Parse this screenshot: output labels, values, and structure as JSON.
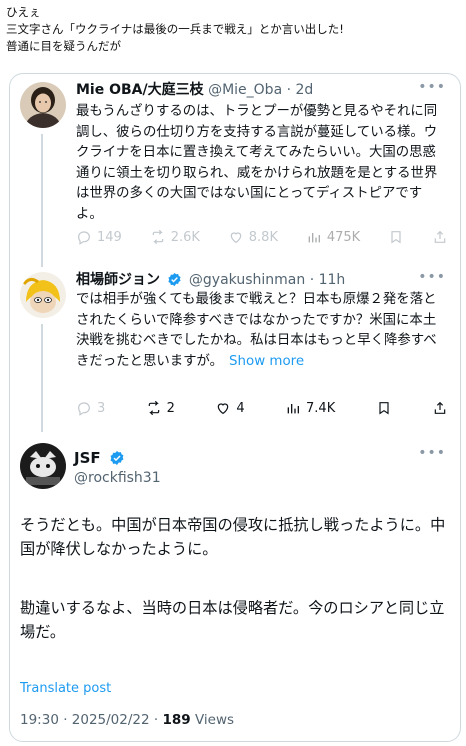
{
  "caption": {
    "line1": "ひえぇ",
    "line2": "三文字さん「ウクライナは最後の一兵まで戦え」とか言い出した!",
    "line3": "普通に目を疑うんだが"
  },
  "tweet1": {
    "name": "Mie OBA/大庭三枝",
    "handle": "@Mie_Oba",
    "time": "· 2d",
    "text": "最もうんざりするのは、トラとプーが優勢と見るやそれに同調し、彼らの仕切り方を支持する言説が蔓延している様。ウクライナを日本に置き換えて考えてみたらいい。大国の思惑通りに領土を切り取られ、威をかけられ放題を是とする世界は世界の多くの大国ではない国にとってディストピアですよ。",
    "replies": "149",
    "reposts": "2.6K",
    "likes": "8.8K",
    "views": "475K"
  },
  "tweet2": {
    "name": "相場師ジョン",
    "handle": "@gyakushinman",
    "time": "· 11h",
    "text": "では相手が強くても最後まで戦えと？日本も原爆２発を落とされたくらいで降参すべきではなかったですか？米国に本土決戦を挑むべきでしたかね。私は日本はもっと早く降参すべきだったと思いますが。",
    "show_more": "Show more",
    "replies": "3",
    "reposts": "2",
    "likes": "4",
    "views": "7.4K"
  },
  "main": {
    "name": "JSF",
    "handle": "@rockfish31",
    "para1": "そうだとも。中国が日本帝国の侵攻に抵抗し戦ったように。中国が降伏しなかったように。",
    "para2": "勘違いするなよ、当時の日本は侵略者だ。今のロシアと同じ立場だ。",
    "translate": "Translate post",
    "datetime": "19:30 · 2025/02/22 · ",
    "views_count": "189",
    "views_label": " Views"
  },
  "colors": {
    "accent": "#1d9bf0",
    "muted": "#536471",
    "border": "#cfd9de",
    "verified": "#1d9bf0"
  },
  "icons": [
    "reply-icon",
    "repost-icon",
    "like-icon",
    "views-icon",
    "bookmark-icon",
    "share-icon",
    "verified-icon",
    "more-icon"
  ]
}
